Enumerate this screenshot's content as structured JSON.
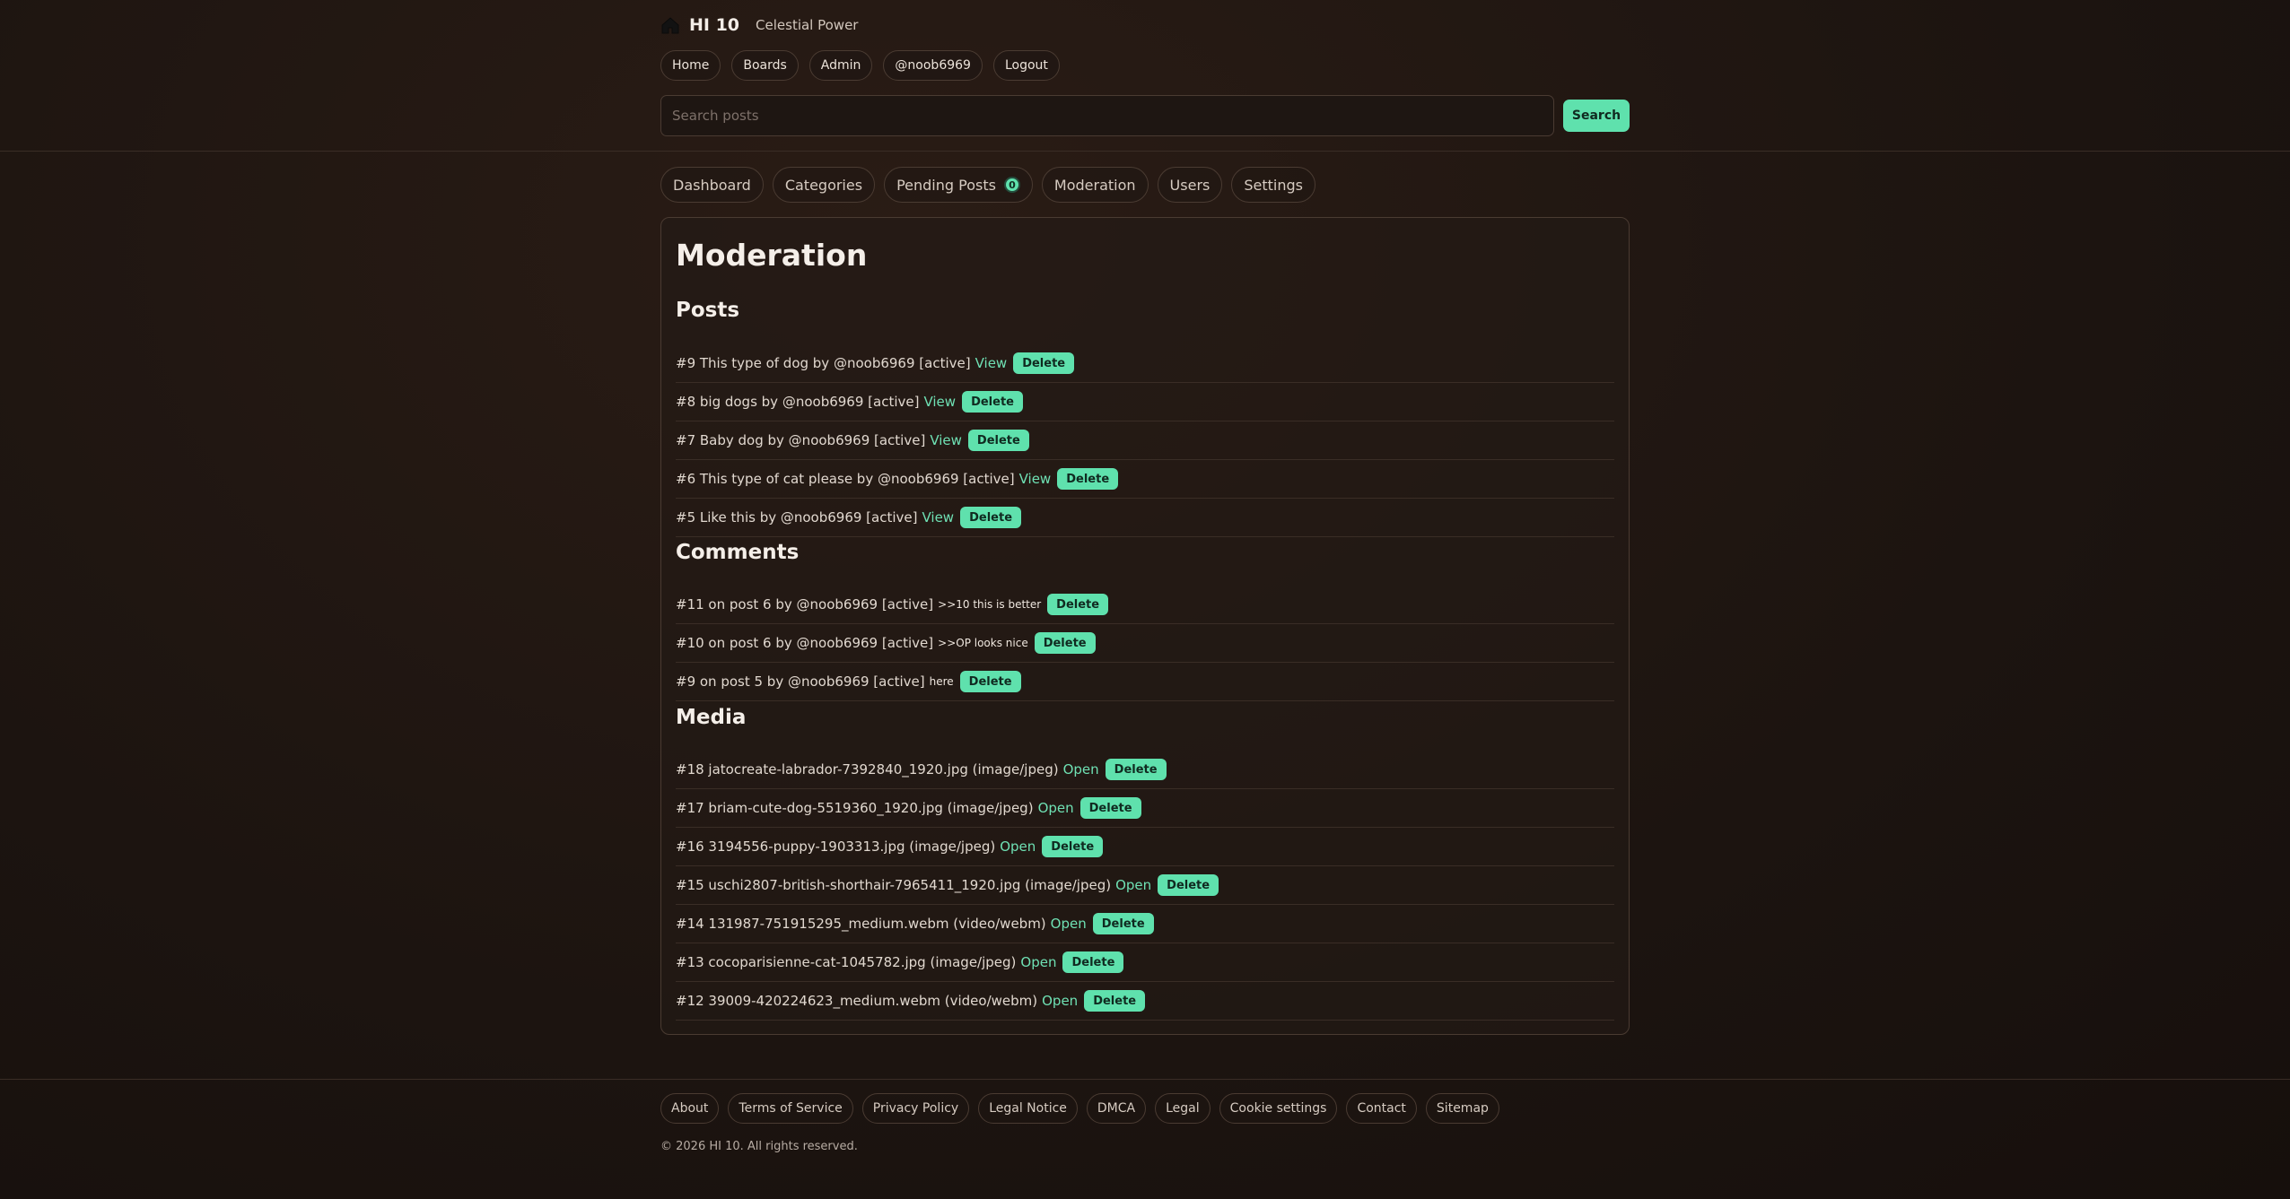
{
  "header": {
    "brand_name": "HI 10",
    "tagline": "Celestial Power",
    "nav": [
      "Home",
      "Boards",
      "Admin",
      "@noob6969",
      "Logout"
    ],
    "search_placeholder": "Search posts",
    "search_button": "Search"
  },
  "tabs": [
    {
      "label": "Dashboard"
    },
    {
      "label": "Categories"
    },
    {
      "label": "Pending Posts",
      "badge": "0"
    },
    {
      "label": "Moderation"
    },
    {
      "label": "Users"
    },
    {
      "label": "Settings"
    }
  ],
  "page": {
    "title": "Moderation",
    "delete_label": "Delete",
    "posts_heading": "Posts",
    "posts": [
      {
        "text": "#9 This type of dog by @noob6969 [active]",
        "link": "View"
      },
      {
        "text": "#8 big dogs by @noob6969 [active]",
        "link": "View"
      },
      {
        "text": "#7 Baby dog by @noob6969 [active]",
        "link": "View"
      },
      {
        "text": "#6 This type of cat please by @noob6969 [active]",
        "link": "View"
      },
      {
        "text": "#5 Like this by @noob6969 [active]",
        "link": "View"
      }
    ],
    "comments_heading": "Comments",
    "comments": [
      {
        "text": "#11 on post 6 by @noob6969 [active]",
        "snippet": ">>10 this is better"
      },
      {
        "text": "#10 on post 6 by @noob6969 [active]",
        "snippet": ">>OP looks nice"
      },
      {
        "text": "#9 on post 5 by @noob6969 [active]",
        "snippet": "here"
      }
    ],
    "media_heading": "Media",
    "media": [
      {
        "text": "#18 jatocreate-labrador-7392840_1920.jpg (image/jpeg)",
        "link": "Open"
      },
      {
        "text": "#17 briam-cute-dog-5519360_1920.jpg (image/jpeg)",
        "link": "Open"
      },
      {
        "text": "#16 3194556-puppy-1903313.jpg (image/jpeg)",
        "link": "Open"
      },
      {
        "text": "#15 uschi2807-british-shorthair-7965411_1920.jpg (image/jpeg)",
        "link": "Open"
      },
      {
        "text": "#14 131987-751915295_medium.webm (video/webm)",
        "link": "Open"
      },
      {
        "text": "#13 cocoparisienne-cat-1045782.jpg (image/jpeg)",
        "link": "Open"
      },
      {
        "text": "#12 39009-420224623_medium.webm (video/webm)",
        "link": "Open"
      }
    ]
  },
  "footer": {
    "links": [
      "About",
      "Terms of Service",
      "Privacy Policy",
      "Legal Notice",
      "DMCA",
      "Legal",
      "Cookie settings",
      "Contact",
      "Sitemap"
    ],
    "copyright": "© 2026 HI 10. All rights reserved."
  },
  "colors": {
    "accent": "#5fe1ad",
    "link": "#6fe1b4",
    "background": "#1c1410"
  }
}
